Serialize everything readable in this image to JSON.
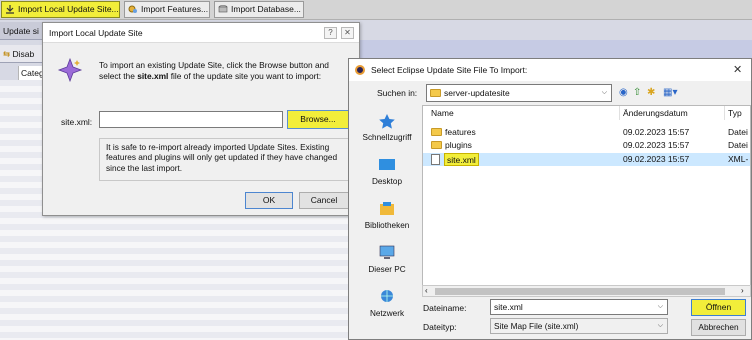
{
  "toolbar": {
    "import_local": "Import Local Update Site...",
    "import_features": "Import Features...",
    "import_database": "Import Database..."
  },
  "left_panel": {
    "tab_update_sites": "Update si",
    "disable_btn": "Disab",
    "category_col": "Categ"
  },
  "import_dialog": {
    "title": "Import Local Update Site",
    "help_btn": "?",
    "close_btn": "✕",
    "intro_pre": "To import an existing Update Site, click the Browse button and select the ",
    "intro_bold": "site.xml",
    "intro_post": " file of the update site you want to import:",
    "field_label": "site.xml:",
    "field_value": "",
    "browse": "Browse...",
    "note": "It is safe to re-import already imported Update Sites. Existing features and plugins will only get updated if they have changed since the last import.",
    "ok": "OK",
    "cancel": "Cancel"
  },
  "file_dialog": {
    "title": "Select Eclipse Update Site File To Import:",
    "close": "✕",
    "look_in_label": "Suchen in:",
    "look_in_value": "server-updatesite",
    "places": [
      "Schnellzugriff",
      "Desktop",
      "Bibliotheken",
      "Dieser PC",
      "Netzwerk"
    ],
    "columns": {
      "name": "Name",
      "date": "Änderungsdatum",
      "type": "Typ"
    },
    "files": [
      {
        "name": "features",
        "date": "09.02.2023 15:57",
        "type": "Datei"
      },
      {
        "name": "plugins",
        "date": "09.02.2023 15:57",
        "type": "Datei"
      },
      {
        "name": "site.xml",
        "date": "09.02.2023 15:57",
        "type": "XML-"
      }
    ],
    "filename_label": "Dateiname:",
    "filename_value": "site.xml",
    "filetype_label": "Dateityp:",
    "filetype_value": "Site Map File (site.xml)",
    "open": "Öffnen",
    "cancel": "Abbrechen"
  },
  "colors": {
    "highlight": "#f2ee3a",
    "selection": "#cce8ff",
    "folder": "#f4c94a"
  }
}
